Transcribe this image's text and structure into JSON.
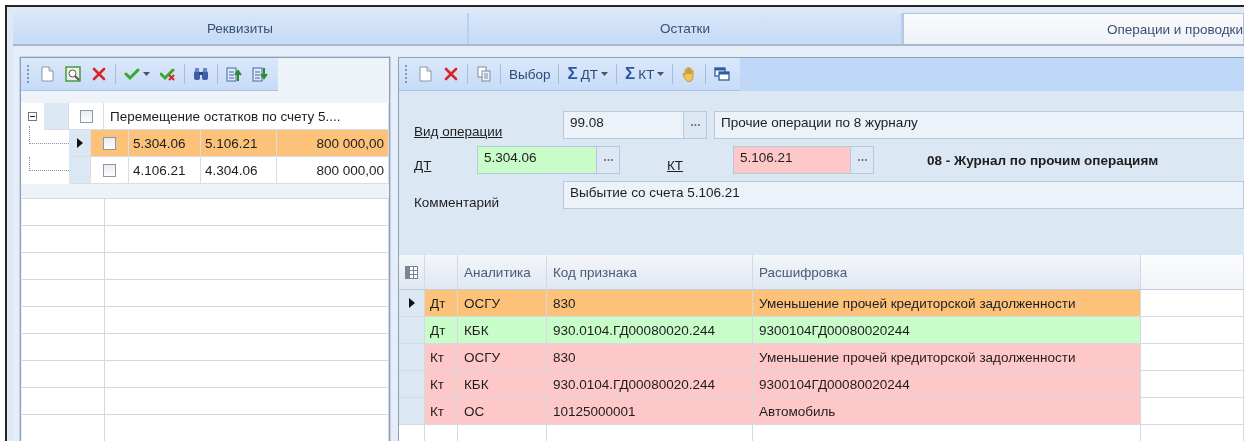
{
  "tabs": [
    {
      "label": "Реквизиты",
      "selected": false
    },
    {
      "label": "Остатки",
      "selected": false
    },
    {
      "label": "Операции и проводки",
      "selected": true
    }
  ],
  "left_toolbar": [
    {
      "kind": "new"
    },
    {
      "kind": "preview"
    },
    {
      "kind": "delete"
    },
    {
      "kind": "separator"
    },
    {
      "kind": "check-menu"
    },
    {
      "kind": "uncheck"
    },
    {
      "kind": "separator"
    },
    {
      "kind": "find"
    },
    {
      "kind": "separator"
    },
    {
      "kind": "move-up"
    },
    {
      "kind": "move-down"
    }
  ],
  "tree": [
    {
      "label": "Перемещение остатков по счету 5....",
      "expanded": true,
      "checked": false,
      "children": [
        {
          "selected": true,
          "checked": false,
          "debit": "5.304.06",
          "credit": "5.106.21",
          "amount": "800 000,00"
        },
        {
          "selected": false,
          "checked": false,
          "debit": "4.106.21",
          "credit": "4.304.06",
          "amount": "800 000,00"
        }
      ]
    }
  ],
  "right_toolbar": [
    {
      "kind": "new"
    },
    {
      "kind": "delete"
    },
    {
      "kind": "separator"
    },
    {
      "kind": "copy"
    },
    {
      "kind": "separator"
    },
    {
      "kind": "text",
      "label": "Выбор"
    },
    {
      "kind": "separator"
    },
    {
      "kind": "sum-menu",
      "symbol": "Σ",
      "label": "ДТ"
    },
    {
      "kind": "separator"
    },
    {
      "kind": "sum-menu",
      "symbol": "Σ",
      "label": "КТ"
    },
    {
      "kind": "separator"
    },
    {
      "kind": "hand"
    },
    {
      "kind": "separator"
    },
    {
      "kind": "windows"
    }
  ],
  "form": {
    "operation_label": "Вид операции",
    "operation_code": "99.08",
    "operation_name": "Прочие операции по 8 журналу",
    "debit": {
      "label": "ДТ",
      "value": "5.304.06",
      "color": "#c8fcc8"
    },
    "credit": {
      "label": "КТ",
      "value": "5.106.21",
      "color": "#ffc8c8"
    },
    "journal": "08 - Журнал по прочим операциям",
    "comment_label": "Комментарий",
    "comment_value": "Выбытие со счета 5.106.21"
  },
  "grid": {
    "columns": [
      "Аналитика",
      "Код признака",
      "Расшифровка"
    ],
    "rows": [
      {
        "selected": true,
        "color": "#fcc27a",
        "side": "Дт",
        "analytics": "ОСГУ",
        "code": "830",
        "decoding": "Уменьшение прочей кредиторской задолженности"
      },
      {
        "selected": false,
        "color": "#c8fcc8",
        "side": "Дт",
        "analytics": "КБК",
        "code": "930.0104.ГД00080020.244",
        "decoding": "9300104ГД00080020244"
      },
      {
        "selected": false,
        "color": "#ffc8c8",
        "side": "Кт",
        "analytics": "ОСГУ",
        "code": "830",
        "decoding": "Уменьшение прочей кредиторской задолженности"
      },
      {
        "selected": false,
        "color": "#ffc8c8",
        "side": "Кт",
        "analytics": "КБК",
        "code": "930.0104.ГД00080020.244",
        "decoding": "9300104ГД00080020244"
      },
      {
        "selected": false,
        "color": "#ffc8c8",
        "side": "Кт",
        "analytics": "ОС",
        "code": "10125000001",
        "decoding": "Автомобиль"
      }
    ]
  }
}
